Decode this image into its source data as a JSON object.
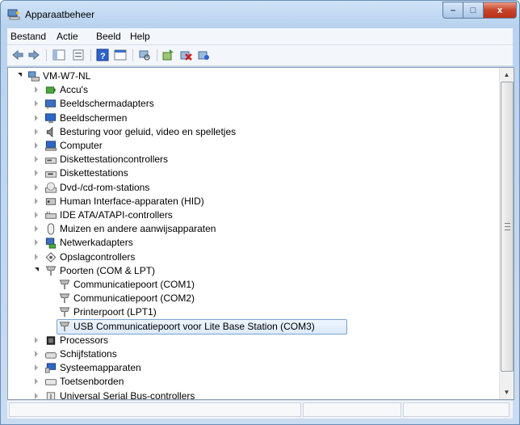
{
  "window": {
    "title": "Apparaatbeheer",
    "title_icon": "device-manager-icon"
  },
  "controls": {
    "minimize": "–",
    "maximize": "□",
    "close": "x"
  },
  "menu": [
    "Bestand",
    "Actie",
    "Beeld",
    "Help"
  ],
  "toolbar": [
    "back-arrow-icon",
    "forward-arrow-icon",
    "show-hide-tree-icon",
    "properties-icon",
    "help-icon",
    "console-view-icon",
    "scan-hardware-icon",
    "update-driver-icon",
    "uninstall-icon",
    "disable-device-icon"
  ],
  "tree": {
    "root": "VM-W7-NL",
    "items": [
      {
        "label": "Accu's",
        "icon": "battery-icon",
        "state": "collapsed"
      },
      {
        "label": "Beeldschermadapters",
        "icon": "display-adapter-icon",
        "state": "collapsed"
      },
      {
        "label": "Beeldschermen",
        "icon": "monitor-icon",
        "state": "collapsed"
      },
      {
        "label": "Besturing voor geluid, video en spelletjes",
        "icon": "speaker-icon",
        "state": "collapsed"
      },
      {
        "label": "Computer",
        "icon": "computer-icon",
        "state": "collapsed"
      },
      {
        "label": "Diskettestationcontrollers",
        "icon": "floppy-controller-icon",
        "state": "collapsed"
      },
      {
        "label": "Diskettestations",
        "icon": "floppy-drive-icon",
        "state": "collapsed"
      },
      {
        "label": "Dvd-/cd-rom-stations",
        "icon": "cd-drive-icon",
        "state": "collapsed"
      },
      {
        "label": "Human Interface-apparaten (HID)",
        "icon": "hid-icon",
        "state": "collapsed"
      },
      {
        "label": "IDE ATA/ATAPI-controllers",
        "icon": "ide-controller-icon",
        "state": "collapsed"
      },
      {
        "label": "Muizen en andere aanwijsapparaten",
        "icon": "mouse-icon",
        "state": "collapsed"
      },
      {
        "label": "Netwerkadapters",
        "icon": "network-adapter-icon",
        "state": "collapsed"
      },
      {
        "label": "Opslagcontrollers",
        "icon": "storage-controller-icon",
        "state": "collapsed"
      },
      {
        "label": "Poorten (COM & LPT)",
        "icon": "port-icon",
        "state": "expanded"
      },
      {
        "label": "Communicatiepoort (COM1)",
        "icon": "port-icon",
        "level": 2
      },
      {
        "label": "Communicatiepoort (COM2)",
        "icon": "port-icon",
        "level": 2
      },
      {
        "label": "Printerpoort (LPT1)",
        "icon": "port-icon",
        "level": 2
      },
      {
        "label": "USB Communicatiepoort voor Lite Base Station (COM3)",
        "icon": "port-icon",
        "level": 2,
        "selected": true
      },
      {
        "label": "Processors",
        "icon": "processor-icon",
        "state": "collapsed"
      },
      {
        "label": "Schijfstations",
        "icon": "disk-drive-icon",
        "state": "collapsed"
      },
      {
        "label": "Systeemapparaten",
        "icon": "system-device-icon",
        "state": "collapsed"
      },
      {
        "label": "Toetsenborden",
        "icon": "keyboard-icon",
        "state": "collapsed"
      },
      {
        "label": "Universal Serial Bus-controllers",
        "icon": "usb-controller-icon",
        "state": "collapsed"
      }
    ]
  },
  "colors": {
    "selection_border": "#7da2ce",
    "selection_fill": "#dbeafc",
    "close_button": "#c6452a"
  }
}
